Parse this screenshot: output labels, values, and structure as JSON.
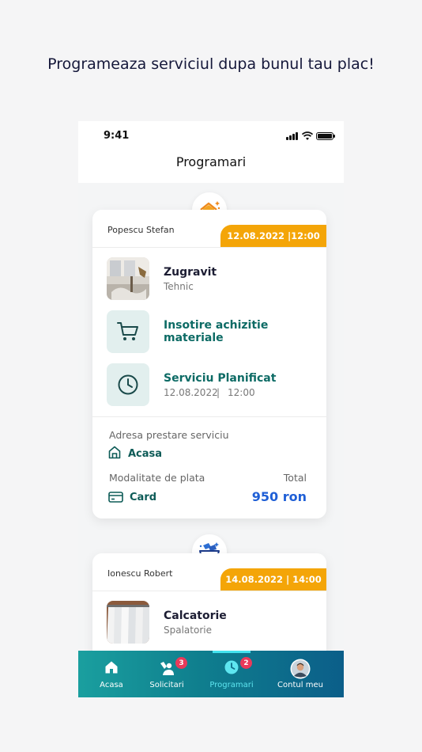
{
  "headline": "Programeaza serviciul dupa bunul tau plac!",
  "status": {
    "time": "9:41"
  },
  "nav": {
    "title": "Programari"
  },
  "appointments": [
    {
      "client": "Popescu Stefan",
      "datetime": "12.08.2022 |12:00",
      "category_icon": "house-sparkle-icon",
      "service": {
        "title": "Zugravit",
        "subtitle": "Tehnic"
      },
      "extra": {
        "title_line1": "Insotire achizitie",
        "title_line2": "materiale"
      },
      "planned": {
        "title": "Serviciu Planificat",
        "date": "12.08.2022",
        "sep": "|",
        "time": "12:00"
      },
      "address_label": "Adresa prestare serviciu",
      "address_value": "Acasa",
      "payment_label": "Modalitate de plata",
      "payment_value": "Card",
      "total_label": "Total",
      "total_value": "950 ron"
    },
    {
      "client": "Ionescu Robert",
      "datetime": "14.08.2022 | 14:00",
      "category_icon": "laundry-basket-icon",
      "service": {
        "title": "Calcatorie",
        "subtitle": "Spalatorie"
      }
    }
  ],
  "tabs": [
    {
      "label": "Acasa",
      "icon": "home-icon"
    },
    {
      "label": "Solicitari",
      "icon": "worker-icon",
      "count": "3"
    },
    {
      "label": "Programari",
      "icon": "clock-icon",
      "count": "2",
      "active": true
    },
    {
      "label": "Contul meu",
      "icon": "avatar"
    }
  ],
  "colors": {
    "accent": "#f4a508",
    "teal": "#0d6b65",
    "price": "#1f5fd6",
    "badge": "#e93a5a"
  }
}
